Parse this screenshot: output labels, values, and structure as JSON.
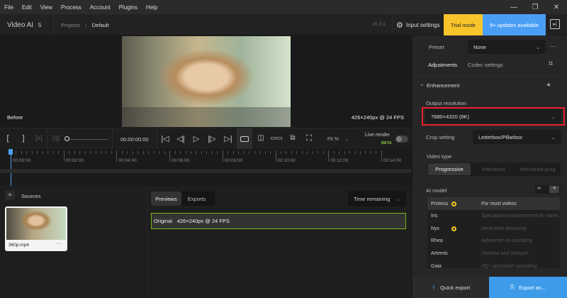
{
  "menu": [
    "File",
    "Edit",
    "View",
    "Process",
    "Account",
    "Plugins",
    "Help"
  ],
  "window_controls": {
    "minimize": "—",
    "restore": "❐",
    "close": "✕"
  },
  "header": {
    "app_name": "Video AI",
    "app_version_major": "5",
    "breadcrumb": [
      "Projects",
      "Default"
    ],
    "version": "v5.3.1",
    "input_settings": "Input settings",
    "trial": "Trial mode",
    "updates": "9+ updates available"
  },
  "colors": {
    "trial": "#f7c52b",
    "updates": "#4a9ff5",
    "export": "#3d9be9",
    "highlight": "#e8202a",
    "selected_border": "#7cb518",
    "beta": "#8cc63f",
    "model_dot": "#f3c623"
  },
  "preview": {
    "left_label": "Before",
    "right_label": "426×240px @ 24 FPS"
  },
  "controls": {
    "timecode": "00:00:00:00",
    "zoom": "Fit %",
    "live_render": "Live render",
    "beta": "BETA",
    "live_render_on": false
  },
  "timeline": {
    "labels": [
      "00:00:00",
      "00:02:00",
      "00:04:00",
      "00:06:00",
      "00:08:00",
      "00:10:00",
      "00:12:00",
      "00:14:00"
    ]
  },
  "sources": {
    "title": "Sources",
    "file": "360p.mp4",
    "more": "···"
  },
  "previews": {
    "tabs": [
      "Previews",
      "Exports"
    ],
    "active_tab": "Previews",
    "sort": "Time remaining",
    "row_label": "Original",
    "row_value": "426×240px @ 24 FPS"
  },
  "right": {
    "preset_label": "Preset",
    "preset_value": "None",
    "more": "···",
    "tabs": [
      "Adjustments",
      "Codec settings"
    ],
    "active_tab": "Adjustments",
    "section": "Enhancement",
    "output_res_label": "Output resolution",
    "output_res_value": "7680×4320 (8K)",
    "crop_label": "Crop setting",
    "crop_value": "Letterbox/Pillarbox",
    "video_type_label": "Video type",
    "video_types": [
      "Progressive",
      "Interlaced",
      "Interlaced prog."
    ],
    "video_type_selected": "Progressive",
    "ai_model_label": "AI model",
    "models": [
      {
        "name": "Proteus",
        "desc": "For most videos",
        "recommended": true,
        "selected": true
      },
      {
        "name": "Iris",
        "desc": "Specialized enhancement for faces",
        "recommended": false
      },
      {
        "name": "Nyx",
        "desc": "Dedicated denoising",
        "recommended": true
      },
      {
        "name": "Rhea",
        "desc": "Advanced 4x upscaling",
        "recommended": false
      },
      {
        "name": "Artemis",
        "desc": "Denoise and sharpen",
        "recommended": false
      },
      {
        "name": "Gaia",
        "desc": "HQ / animation upscaling",
        "recommended": false
      }
    ]
  },
  "footer": {
    "quick_export": "Quick export",
    "export_as": "Export as..."
  }
}
